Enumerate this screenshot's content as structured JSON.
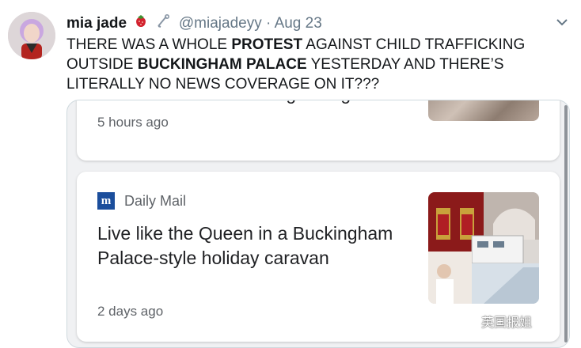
{
  "tweet": {
    "name": "mia jade",
    "handle": "@miajadeyy",
    "separator": "·",
    "date": "Aug 23",
    "text_parts": [
      "THERE WAS A WHOLE ",
      "PROTEST",
      " AGAINST CHILD TRAFFICKING OUTSIDE ",
      "BUCKINGHAM PALACE",
      " YESTERDAY AND THERE’S LITERALLY NO NEWS COVERAGE ON IT???"
    ],
    "icons": [
      "strawberry-emoji",
      "safety-pin-emoji",
      "chevron-down-icon"
    ]
  },
  "cards": {
    "card1": {
      "headline": "foreseeable future' in big change",
      "time": "5 hours ago"
    },
    "card2": {
      "source": "Daily Mail",
      "source_logo_letter": "m",
      "headline": "Live like the Queen in a Buckingham Palace-style holiday caravan",
      "time": "2 days ago"
    }
  },
  "watermark": "英国报姐",
  "colors": {
    "text": "#14171a",
    "muted": "#657786",
    "daily_mail_blue": "#1b4e9c",
    "card_bg": "#ffffff"
  }
}
